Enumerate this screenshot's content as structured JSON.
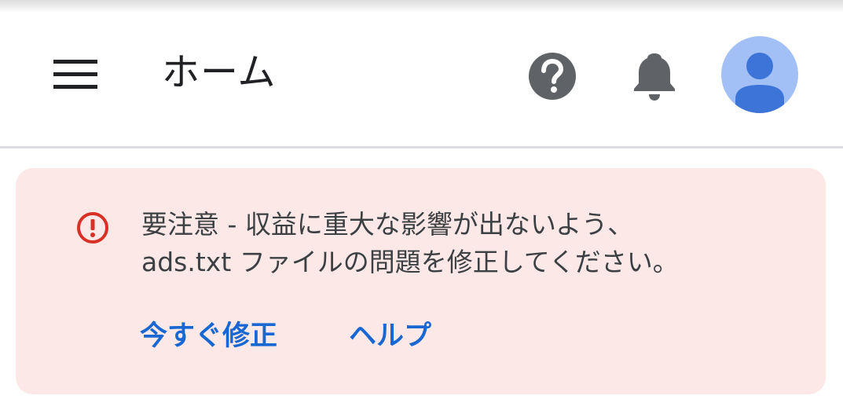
{
  "header": {
    "title": "ホーム",
    "icons": {
      "menu": "hamburger-menu-icon",
      "help": "help-circle-icon",
      "notifications": "bell-icon",
      "account": "account-avatar-icon"
    }
  },
  "alert": {
    "icon": "error-outline-icon",
    "message_line1": "要注意 - 収益に重大な影響が出ないよう、",
    "message_line2": "ads.txt ファイルの問題を修正してください。",
    "actions": {
      "fix_now": "今すぐ修正",
      "help": "ヘルプ"
    }
  },
  "colors": {
    "alert_background": "#fce8e6",
    "alert_icon": "#d93025",
    "link": "#1967d2",
    "icon_gray": "#5f6368",
    "avatar_background": "#a3c0f6",
    "avatar_figure": "#3c74d8"
  }
}
